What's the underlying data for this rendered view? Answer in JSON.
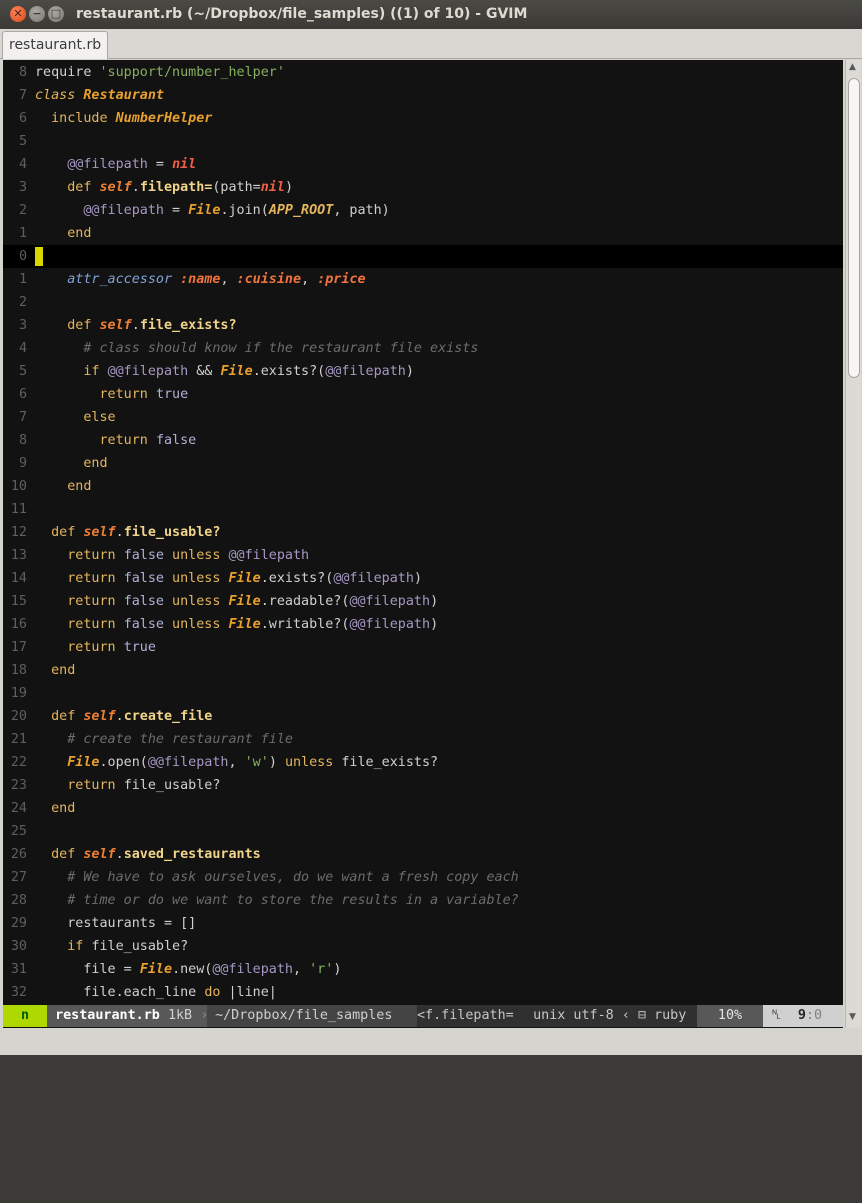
{
  "window": {
    "title": "restaurant.rb (~/Dropbox/file_samples) ((1) of 10) - GVIM",
    "close_glyph": "✕",
    "minimize_glyph": "−",
    "maximize_glyph": "□"
  },
  "tab": {
    "label": "restaurant.rb"
  },
  "status": {
    "mode": "n",
    "filename": "restaurant.rb",
    "filesize": "1kB",
    "path": "~/Dropbox/file_samples",
    "tag": "<f.filepath=",
    "encoding": "unix utf-8",
    "filetype": "ruby",
    "percent": "10%",
    "line": "9",
    "col": "0"
  },
  "lines": [
    {
      "n": "8",
      "tokens": [
        [
          "require ",
          ""
        ],
        [
          "'support/number_helper'",
          "str"
        ]
      ]
    },
    {
      "n": "7",
      "tokens": [
        [
          "class ",
          "kwi"
        ],
        [
          "Restaurant",
          "cls"
        ]
      ]
    },
    {
      "n": "6",
      "tokens": [
        [
          "  include ",
          "kw"
        ],
        [
          "NumberHelper",
          "cls"
        ]
      ]
    },
    {
      "n": "5",
      "tokens": []
    },
    {
      "n": "4",
      "tokens": [
        [
          "    ",
          ""
        ],
        [
          "@@filepath",
          "ivar"
        ],
        [
          " = ",
          ""
        ],
        [
          "nil",
          "nil"
        ]
      ]
    },
    {
      "n": "3",
      "tokens": [
        [
          "    def ",
          "kw"
        ],
        [
          "self",
          "slf"
        ],
        [
          ".",
          ""
        ],
        [
          "filepath=",
          "fn"
        ],
        [
          "(path=",
          ""
        ],
        [
          "nil",
          "nil"
        ],
        [
          ")",
          ""
        ]
      ]
    },
    {
      "n": "2",
      "tokens": [
        [
          "      ",
          ""
        ],
        [
          "@@filepath",
          "ivar"
        ],
        [
          " = ",
          ""
        ],
        [
          "File",
          "cls"
        ],
        [
          ".join(",
          ""
        ],
        [
          "APP_ROOT",
          "cst"
        ],
        [
          ", path)",
          ""
        ]
      ]
    },
    {
      "n": "1",
      "tokens": [
        [
          "    end",
          "kw"
        ]
      ]
    },
    {
      "n": "0",
      "tokens": [],
      "current": true
    },
    {
      "n": "1",
      "tokens": [
        [
          "    ",
          ""
        ],
        [
          "attr_accessor",
          "attr"
        ],
        [
          " ",
          ""
        ],
        [
          ":name",
          "sym"
        ],
        [
          ", ",
          ""
        ],
        [
          ":cuisine",
          "sym"
        ],
        [
          ", ",
          ""
        ],
        [
          ":price",
          "sym"
        ]
      ]
    },
    {
      "n": "2",
      "tokens": []
    },
    {
      "n": "3",
      "tokens": [
        [
          "    def ",
          "kw"
        ],
        [
          "self",
          "slf"
        ],
        [
          ".",
          ""
        ],
        [
          "file_exists?",
          "fn"
        ]
      ]
    },
    {
      "n": "4",
      "tokens": [
        [
          "      # class should know if the restaurant file exists",
          "cmt"
        ]
      ]
    },
    {
      "n": "5",
      "tokens": [
        [
          "      if ",
          "kw"
        ],
        [
          "@@filepath",
          "ivar"
        ],
        [
          " && ",
          ""
        ],
        [
          "File",
          "cls"
        ],
        [
          ".exists?(",
          ""
        ],
        [
          "@@filepath",
          "ivar"
        ],
        [
          ")",
          ""
        ]
      ]
    },
    {
      "n": "6",
      "tokens": [
        [
          "        return ",
          "kw"
        ],
        [
          "true",
          "bool"
        ]
      ]
    },
    {
      "n": "7",
      "tokens": [
        [
          "      else",
          "kw"
        ]
      ]
    },
    {
      "n": "8",
      "tokens": [
        [
          "        return ",
          "kw"
        ],
        [
          "false",
          "bool"
        ]
      ]
    },
    {
      "n": "9",
      "tokens": [
        [
          "      end",
          "kw"
        ]
      ]
    },
    {
      "n": "10",
      "tokens": [
        [
          "    end",
          "kw"
        ]
      ]
    },
    {
      "n": "11",
      "tokens": []
    },
    {
      "n": "12",
      "tokens": [
        [
          "  def ",
          "kw"
        ],
        [
          "self",
          "slf"
        ],
        [
          ".",
          ""
        ],
        [
          "file_usable?",
          "fn"
        ]
      ]
    },
    {
      "n": "13",
      "tokens": [
        [
          "    return ",
          "kw"
        ],
        [
          "false",
          "bool"
        ],
        [
          " unless ",
          "kw"
        ],
        [
          "@@filepath",
          "ivar"
        ]
      ]
    },
    {
      "n": "14",
      "tokens": [
        [
          "    return ",
          "kw"
        ],
        [
          "false",
          "bool"
        ],
        [
          " unless ",
          "kw"
        ],
        [
          "File",
          "cls"
        ],
        [
          ".exists?(",
          ""
        ],
        [
          "@@filepath",
          "ivar"
        ],
        [
          ")",
          ""
        ]
      ]
    },
    {
      "n": "15",
      "tokens": [
        [
          "    return ",
          "kw"
        ],
        [
          "false",
          "bool"
        ],
        [
          " unless ",
          "kw"
        ],
        [
          "File",
          "cls"
        ],
        [
          ".readable?(",
          ""
        ],
        [
          "@@filepath",
          "ivar"
        ],
        [
          ")",
          ""
        ]
      ]
    },
    {
      "n": "16",
      "tokens": [
        [
          "    return ",
          "kw"
        ],
        [
          "false",
          "bool"
        ],
        [
          " unless ",
          "kw"
        ],
        [
          "File",
          "cls"
        ],
        [
          ".writable?(",
          ""
        ],
        [
          "@@filepath",
          "ivar"
        ],
        [
          ")",
          ""
        ]
      ]
    },
    {
      "n": "17",
      "tokens": [
        [
          "    return ",
          "kw"
        ],
        [
          "true",
          "bool"
        ]
      ]
    },
    {
      "n": "18",
      "tokens": [
        [
          "  end",
          "kw"
        ]
      ]
    },
    {
      "n": "19",
      "tokens": []
    },
    {
      "n": "20",
      "tokens": [
        [
          "  def ",
          "kw"
        ],
        [
          "self",
          "slf"
        ],
        [
          ".",
          ""
        ],
        [
          "create_file",
          "fn"
        ]
      ]
    },
    {
      "n": "21",
      "tokens": [
        [
          "    # create the restaurant file",
          "cmt"
        ]
      ]
    },
    {
      "n": "22",
      "tokens": [
        [
          "    ",
          ""
        ],
        [
          "File",
          "cls"
        ],
        [
          ".open(",
          ""
        ],
        [
          "@@filepath",
          "ivar"
        ],
        [
          ", ",
          ""
        ],
        [
          "'w'",
          "str"
        ],
        [
          ") ",
          ""
        ],
        [
          "unless",
          "kw"
        ],
        [
          " file_exists?",
          ""
        ]
      ]
    },
    {
      "n": "23",
      "tokens": [
        [
          "    return ",
          "kw"
        ],
        [
          "file_usable?",
          ""
        ]
      ]
    },
    {
      "n": "24",
      "tokens": [
        [
          "  end",
          "kw"
        ]
      ]
    },
    {
      "n": "25",
      "tokens": []
    },
    {
      "n": "26",
      "tokens": [
        [
          "  def ",
          "kw"
        ],
        [
          "self",
          "slf"
        ],
        [
          ".",
          ""
        ],
        [
          "saved_restaurants",
          "fn"
        ]
      ]
    },
    {
      "n": "27",
      "tokens": [
        [
          "    # We have to ask ourselves, do we want a fresh copy each",
          "cmt"
        ]
      ]
    },
    {
      "n": "28",
      "tokens": [
        [
          "    # time or do we want to store the results in a variable?",
          "cmt"
        ]
      ]
    },
    {
      "n": "29",
      "tokens": [
        [
          "    restaurants = []",
          ""
        ]
      ]
    },
    {
      "n": "30",
      "tokens": [
        [
          "    if ",
          "kw"
        ],
        [
          "file_usable?",
          ""
        ]
      ]
    },
    {
      "n": "31",
      "tokens": [
        [
          "      file = ",
          ""
        ],
        [
          "File",
          "cls"
        ],
        [
          ".new(",
          ""
        ],
        [
          "@@filepath",
          "ivar"
        ],
        [
          ", ",
          ""
        ],
        [
          "'r'",
          "str"
        ],
        [
          ")",
          ""
        ]
      ]
    },
    {
      "n": "32",
      "tokens": [
        [
          "      file.each_line ",
          ""
        ],
        [
          "do",
          "kw"
        ],
        [
          " |line|",
          ""
        ]
      ]
    }
  ]
}
